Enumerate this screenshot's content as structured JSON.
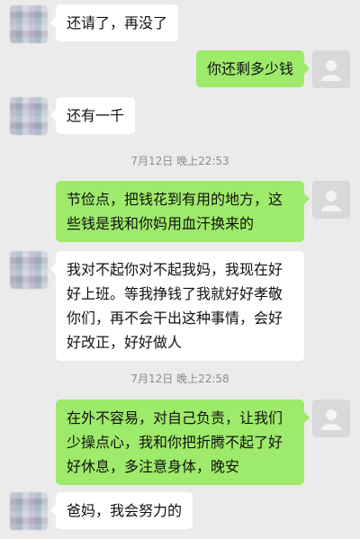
{
  "chat": {
    "messages": [
      {
        "side": "left",
        "text": "还请了，再没了"
      },
      {
        "side": "right",
        "text": "你还剩多少钱"
      },
      {
        "side": "left",
        "text": "还有一千"
      },
      {
        "timestamp": "7月12日 晚上22:53"
      },
      {
        "side": "right",
        "text": "节俭点，把钱花到有用的地方，这些钱是我和你妈用血汗换来的"
      },
      {
        "side": "left",
        "text": "我对不起你对不起我妈，我现在好好上班。等我挣钱了我就好好孝敬你们，再不会干出这种事情，会好好改正，好好做人"
      },
      {
        "timestamp": "7月12日 晚上22:58"
      },
      {
        "side": "right",
        "text": "在外不容易，对自己负责，让我们少操点心，我和你把折腾不起了好好休息，多注意身体，晚安"
      },
      {
        "side": "left",
        "text": "爸妈，我会努力的"
      }
    ]
  },
  "colors": {
    "background": "#ebebeb",
    "sent_bubble": "#9eea6a",
    "received_bubble": "#ffffff"
  },
  "icons": {
    "self_avatar": "person-silhouette-icon",
    "other_avatar": "blurred-photo-avatar"
  }
}
